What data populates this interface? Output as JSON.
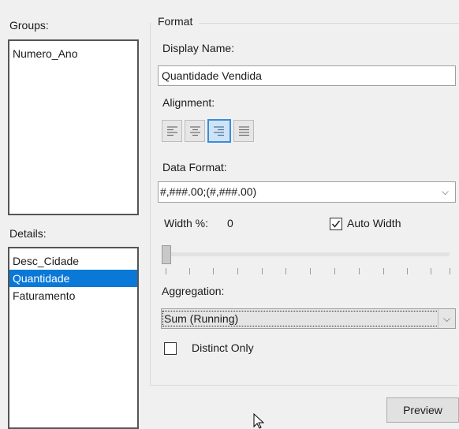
{
  "groups": {
    "label": "Groups:",
    "items": [
      "Numero_Ano"
    ]
  },
  "details": {
    "label": "Details:",
    "items": [
      "Desc_Cidade",
      "Quantidade",
      "Faturamento"
    ],
    "selected": "Quantidade"
  },
  "format": {
    "title": "Format",
    "display_name_label": "Display Name:",
    "display_name_value": "Quantidade Vendida",
    "alignment_label": "Alignment:",
    "alignment_buttons": [
      "align-left-icon",
      "align-center-icon",
      "align-right-icon",
      "align-justify-icon"
    ],
    "alignment_selected": "align-right",
    "data_format_label": "Data Format:",
    "data_format_value": "#,###.00;(#,###.00)",
    "width_label": "Width %:",
    "width_value": "0",
    "auto_width_label": "Auto Width",
    "auto_width_checked": true,
    "width_slider_value_percent": 0,
    "aggregation_label": "Aggregation:",
    "aggregation_value": "Sum (Running)",
    "distinct_only_label": "Distinct Only",
    "distinct_only_checked": false
  },
  "preview_button": "Preview",
  "colors": {
    "selection": "#0a78d7",
    "panel_bg": "#f0f0f0",
    "active_button_border": "#3a8ddb"
  }
}
